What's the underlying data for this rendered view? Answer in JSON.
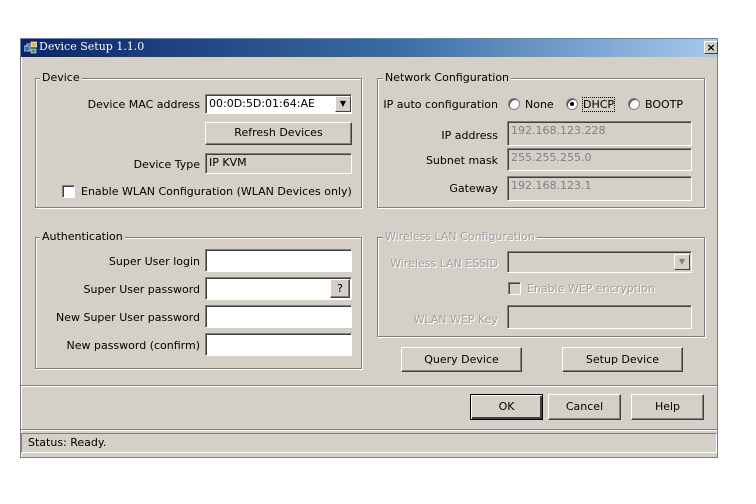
{
  "window": {
    "title": "Device Setup 1.1.0",
    "close_label": "×"
  },
  "device": {
    "legend": "Device",
    "mac_label": "Device MAC address",
    "mac_value": "00:0D:5D:01:64:AE",
    "refresh_label": "Refresh Devices",
    "type_label": "Device Type",
    "type_value": "IP KVM",
    "wlan_enable_label": "Enable WLAN Configuration (WLAN Devices only)"
  },
  "network": {
    "legend": "Network Configuration",
    "auto_label": "IP auto configuration",
    "options": [
      "None",
      "DHCP",
      "BOOTP"
    ],
    "selected": "DHCP",
    "ip_label": "IP address",
    "ip_value": "192.168.123.228",
    "mask_label": "Subnet mask",
    "mask_value": "255.255.255.0",
    "gateway_label": "Gateway",
    "gateway_value": "192.168.123.1"
  },
  "auth": {
    "legend": "Authentication",
    "login_label": "Super User login",
    "login_value": "",
    "password_label": "Super User password",
    "password_value": "",
    "help_label": "?",
    "new_password_label": "New Super User password",
    "new_password_value": "",
    "confirm_label": "New password (confirm)",
    "confirm_value": ""
  },
  "wireless": {
    "legend": "Wireless LAN Configuration",
    "essid_label": "Wireless LAN ESSID",
    "essid_value": "",
    "wep_enable_label": "Enable WEP encryption",
    "wep_key_label": "WLAN WEP Key",
    "wep_key_value": ""
  },
  "actions": {
    "query_label": "Query Device",
    "setup_label": "Setup Device"
  },
  "footer": {
    "ok_label": "OK",
    "cancel_label": "Cancel",
    "help_label": "Help"
  },
  "status": {
    "text": "Status: Ready."
  },
  "colors": {
    "titlebar_start": "#0a246a",
    "titlebar_end": "#a6caf0",
    "face": "#d4d0c8"
  }
}
